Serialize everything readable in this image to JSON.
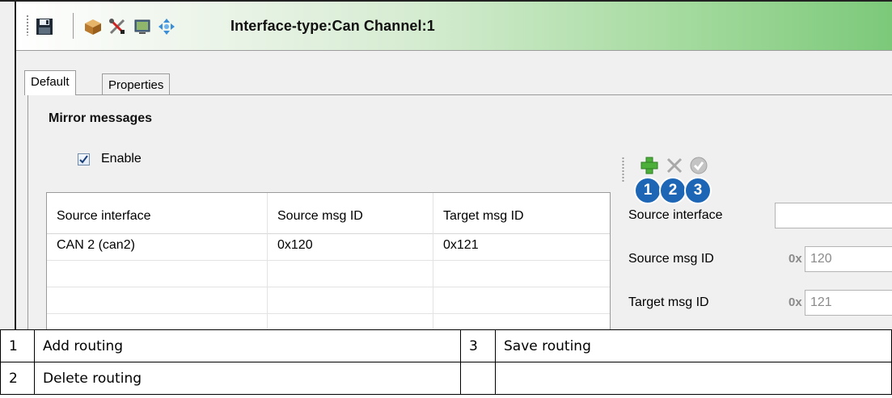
{
  "window": {
    "title": "Interface-type:Can Channel:1"
  },
  "toolbar": {
    "icons": [
      "save-icon",
      "package-icon",
      "tools-icon",
      "monitor-icon",
      "network-arrows-icon"
    ]
  },
  "tabs": [
    {
      "label": "Default",
      "active": true
    },
    {
      "label": "Properties",
      "active": false
    }
  ],
  "mirror": {
    "group_title": "Mirror messages",
    "enable_label": "Enable",
    "enabled": true
  },
  "table": {
    "columns": [
      "Source interface",
      "Source msg ID",
      "Target msg ID"
    ],
    "rows": [
      [
        "CAN  2 (can2)",
        "0x120",
        "0x121"
      ]
    ]
  },
  "routing_toolbar": {
    "icons": [
      "add-icon",
      "delete-icon",
      "save-check-icon"
    ],
    "badges": [
      "1",
      "2",
      "3"
    ]
  },
  "form": {
    "source_interface_label": "Source interface",
    "source_interface_value": "",
    "source_msg_label": "Source msg ID",
    "source_msg_prefix": "0x",
    "source_msg_value": "120",
    "target_msg_label": "Target msg ID",
    "target_msg_prefix": "0x",
    "target_msg_value": "121"
  },
  "legend": {
    "rows": [
      {
        "num1": "1",
        "text1": "Add routing",
        "num2": "3",
        "text2": "Save routing"
      },
      {
        "num1": "2",
        "text1": "Delete routing",
        "num2": "",
        "text2": ""
      }
    ]
  },
  "colors": {
    "badge": "#1c66b5",
    "toolbar_gradient_end": "#7cc97a"
  }
}
